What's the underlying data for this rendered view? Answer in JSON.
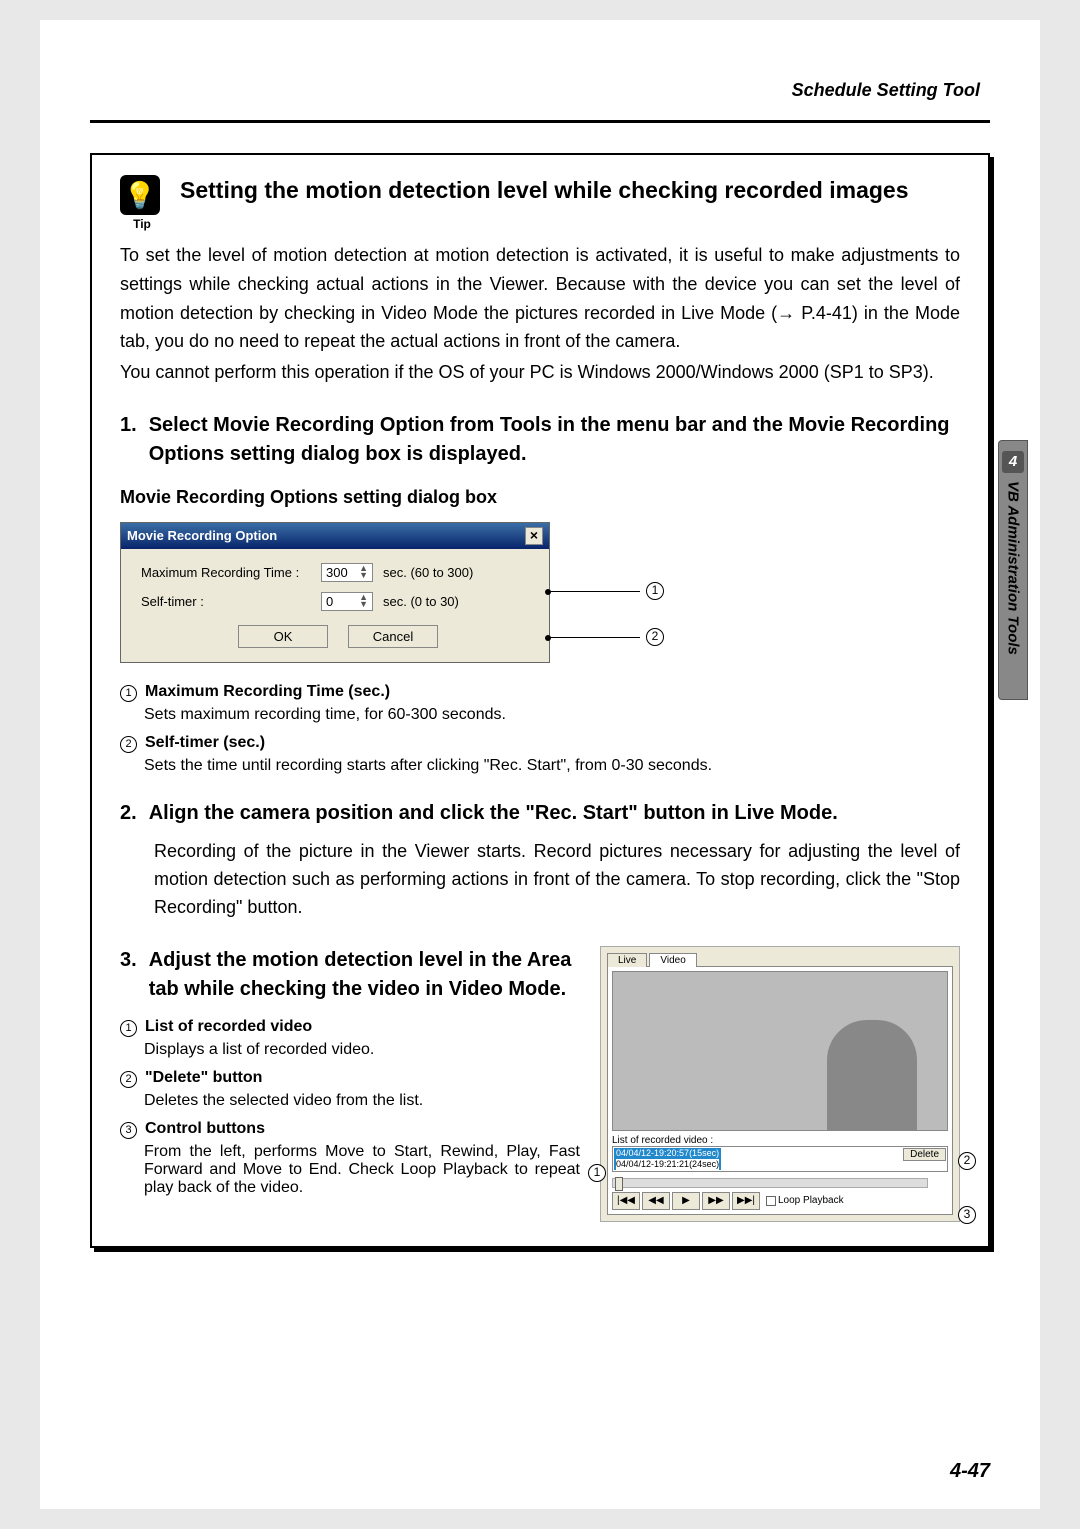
{
  "header": {
    "title": "Schedule Setting Tool"
  },
  "sideTab": {
    "num": "4",
    "text": "VB Administration Tools"
  },
  "pageNumber": "4-47",
  "tip": {
    "iconLabel": "Tip",
    "title": "Setting the motion detection level while checking recorded images",
    "para1": "To set the level of motion detection at motion detection is activated, it is useful to make adjustments to settings while checking actual actions in the Viewer. Because with the device you can set the level of motion detection by checking in Video Mode the pictures recorded in Live Mode (→ P.4-41) in the Mode tab, you do no need to repeat the actual actions in front of the camera.",
    "para2": "You cannot perform this operation if the OS of your PC is Windows 2000/Windows 2000 (SP1 to SP3)."
  },
  "step1": {
    "num": "1.",
    "title": "Select Movie Recording Option from Tools in the menu bar and the Movie Recording Options setting dialog box is displayed.",
    "subHeading": "Movie Recording Options setting dialog box"
  },
  "dialog": {
    "title": "Movie Recording Option",
    "row1Label": "Maximum Recording Time :",
    "row1Value": "300",
    "row1Range": "sec. (60 to 300)",
    "row2Label": "Self-timer :",
    "row2Value": "0",
    "row2Range": "sec. (0 to 30)",
    "ok": "OK",
    "cancel": "Cancel"
  },
  "callouts": {
    "c1": "1",
    "c2": "2",
    "c3": "3"
  },
  "defs1": {
    "d1Label": "Maximum Recording Time (sec.)",
    "d1Desc": "Sets maximum recording time, for 60-300 seconds.",
    "d2Label": "Self-timer (sec.)",
    "d2Desc": "Sets the time until recording starts after clicking \"Rec. Start\", from 0-30 seconds."
  },
  "step2": {
    "num": "2.",
    "title": "Align the camera position and click the \"Rec. Start\" button in Live Mode.",
    "body": "Recording of the picture in the Viewer starts. Record pictures necessary for adjusting the level of motion detection such as performing actions in front of the camera.\nTo stop recording, click the \"Stop Recording\" button."
  },
  "step3": {
    "num": "3.",
    "title": "Adjust the motion detection level in the Area tab while checking the video in Video Mode."
  },
  "defs3": {
    "d1Label": "List of recorded video",
    "d1Desc": "Displays a list of recorded video.",
    "d2Label": "\"Delete\" button",
    "d2Desc": "Deletes the selected video from the list.",
    "d3Label": "Control buttons",
    "d3Desc": "From the left, performs Move to Start, Rewind, Play, Fast Forward and Move to End. Check Loop Playback to repeat play back of the video."
  },
  "videoPanel": {
    "tabLive": "Live",
    "tabVideo": "Video",
    "listLabel": "List of recorded video :",
    "item1": "04/04/12-19:20:57(15sec)",
    "item2": "04/04/12-19:21:21(24sec)",
    "delete": "Delete",
    "loop": "Loop Playback"
  }
}
